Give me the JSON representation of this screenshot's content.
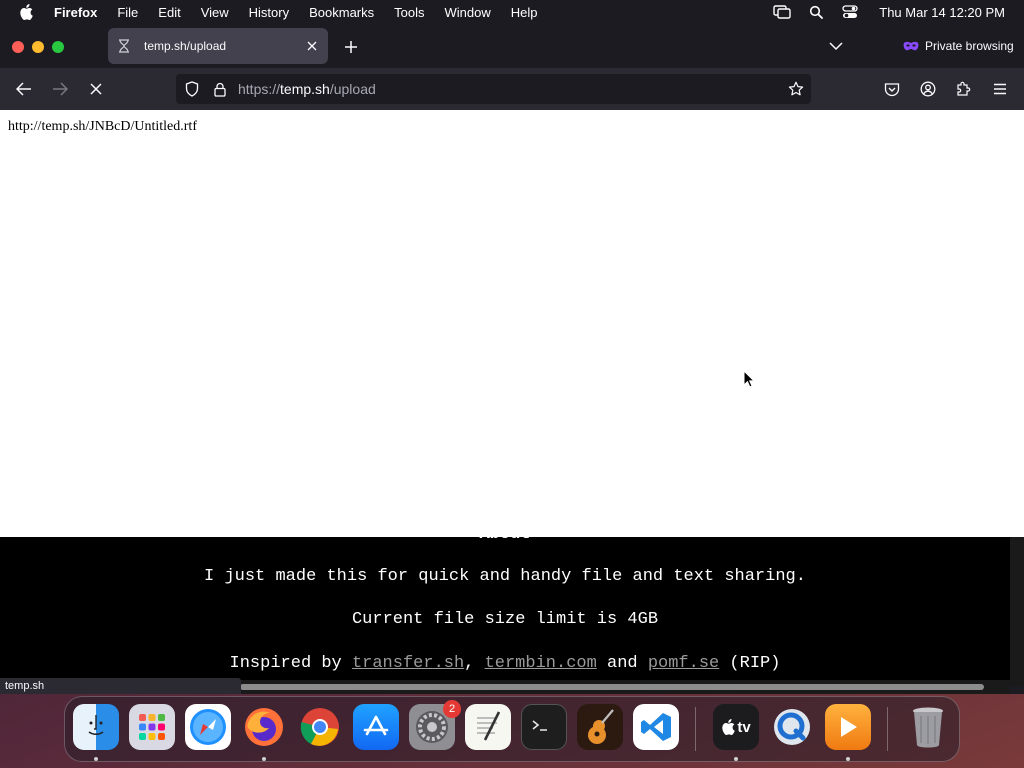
{
  "menubar": {
    "app_name": "Firefox",
    "items": [
      "File",
      "Edit",
      "View",
      "History",
      "Bookmarks",
      "Tools",
      "Window",
      "Help"
    ],
    "clock": "Thu Mar 14  12:20 PM"
  },
  "browser": {
    "tab": {
      "title": "temp.sh/upload"
    },
    "private_label": "Private browsing",
    "url": {
      "scheme": "https://",
      "host": "temp.sh",
      "path": "/upload"
    },
    "status_text": "temp.sh"
  },
  "page": {
    "response_text": "http://temp.sh/JNBcD/Untitled.rtf",
    "about_heading": "About",
    "line1": "I just made this for quick and handy file and text sharing.",
    "line2": "Current file size limit is 4GB",
    "line3": {
      "prefix": "Inspired by ",
      "link1": "transfer.sh",
      "sep1": ", ",
      "link2": "termbin.com",
      "sep2": " and ",
      "link3": "pomf.se",
      "suffix": " (RIP)"
    }
  },
  "dock": {
    "apps": [
      {
        "name": "finder",
        "running": true
      },
      {
        "name": "launchpad",
        "running": false
      },
      {
        "name": "safari",
        "running": false
      },
      {
        "name": "firefox",
        "running": true
      },
      {
        "name": "chrome",
        "running": false
      },
      {
        "name": "app-store",
        "running": false
      },
      {
        "name": "system-settings",
        "running": false,
        "badge": "2"
      },
      {
        "name": "textedit",
        "running": false
      },
      {
        "name": "terminal",
        "running": false
      },
      {
        "name": "garageband",
        "running": false
      },
      {
        "name": "vscode",
        "running": false
      },
      {
        "name": "apple-tv",
        "running": true
      },
      {
        "name": "quicktime",
        "running": false
      },
      {
        "name": "infuse",
        "running": true
      },
      {
        "name": "trash",
        "running": false
      }
    ],
    "tv_label": "tv"
  },
  "colors": {
    "menubar_bg": "#1c1b22",
    "tab_bg": "#42414d",
    "navbar_bg": "#2b2a33",
    "private_accent": "#8a4bff",
    "link_gray": "#9a9a9a"
  }
}
